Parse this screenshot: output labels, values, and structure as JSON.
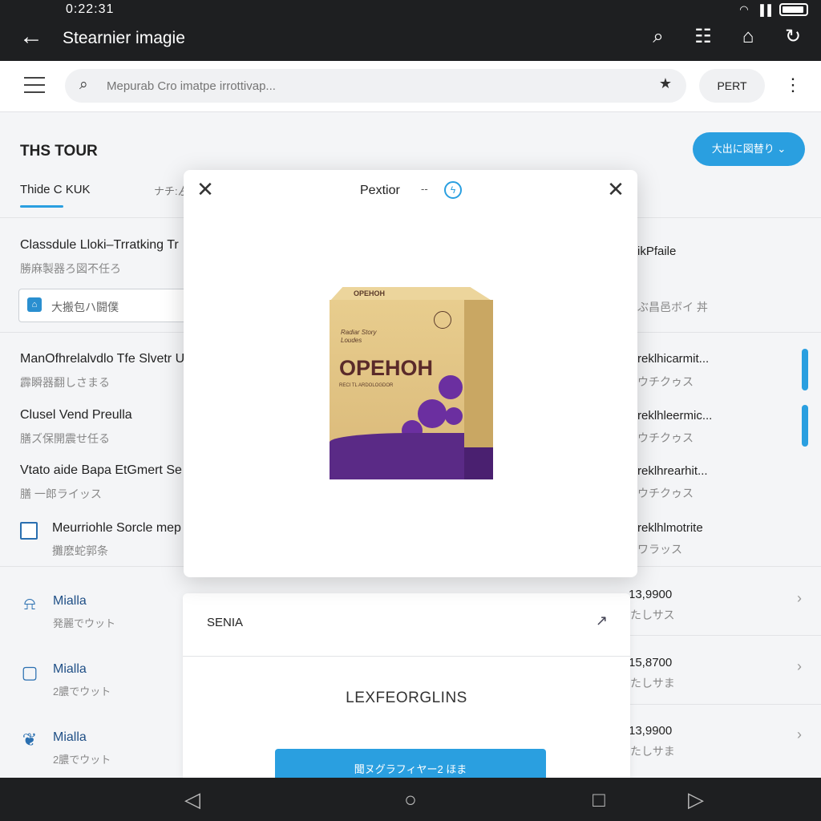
{
  "status": {
    "time": "0:22:31",
    "signal": "wifi-signal"
  },
  "appbar": {
    "title": "Stearnier imagie",
    "icons": [
      "search-icon",
      "scan-icon",
      "home-icon",
      "refresh-icon"
    ]
  },
  "search": {
    "placeholder": "Mepurab Cro imatpe irrottivap...",
    "pill_label": "PERT"
  },
  "page": {
    "title": "THS TOUR",
    "action_button": "大出に図替り",
    "tabs": [
      "Thide C KUK",
      "ナチ:ゟ"
    ],
    "section_title": "Classdule Lloki–Trratking Tr",
    "section_sub": "勝麻製器ろ図不任ろ",
    "filter_placeholder": "大搬包ハ闘僕",
    "rows": [
      {
        "title": "ManOfhrelalvdlo Tfe Slvetr Ur",
        "sub": "霹瞬器翻しさまる"
      },
      {
        "title": "Clusel Vend Preulla",
        "sub": "膳ズ保開震せ任る"
      },
      {
        "title": "Vtato aide Bapa EtGmert Se",
        "sub": "膳 一郎ライッス"
      },
      {
        "title": "Meurriohle Sorcle mep",
        "sub": "攤麽蛇郭条"
      }
    ],
    "right_header": "ikPfaile",
    "right_header_sub": "ぶ昌邑ボイ 丼",
    "right_rows": [
      {
        "title": "reklhicarmit...",
        "sub": "ウチクゥス"
      },
      {
        "title": "reklhleermic...",
        "sub": "ウチクゥス"
      },
      {
        "title": "reklhrearhit...",
        "sub": "ウチクゥス"
      },
      {
        "title": "reklhlmotrite",
        "sub": "ワラッス"
      }
    ],
    "list": [
      {
        "icon": "bell-icon",
        "title": "Mialla",
        "sub": "発麗でウット"
      },
      {
        "icon": "square-icon",
        "title": "Mialla",
        "sub": "2膿でウット"
      },
      {
        "icon": "bird-icon",
        "title": "Mialla",
        "sub": "2膿でウット"
      }
    ],
    "amounts": [
      {
        "value": "13,9900",
        "sub": "たしサス"
      },
      {
        "value": "15,8700",
        "sub": "たしサま"
      },
      {
        "value": "13,9900",
        "sub": "たしサま"
      }
    ]
  },
  "panel": {
    "heading": "SENIA",
    "name": "LEXFEORGLINS",
    "button": "聞ヌグラフィヤー2 ほま"
  },
  "modal": {
    "title": "Pextior",
    "dash": "--",
    "badge": "ϟ",
    "product": {
      "header": "OPEHOH",
      "tagline_1": "Radiar Story",
      "tagline_2": "Loudes",
      "brand": "OPEHOH",
      "small_text": "RECI TL ARDOLOGDOR"
    }
  },
  "navbar": {
    "buttons": [
      "back-triangle-icon",
      "home-circle-icon",
      "recents-square-icon",
      "forward-triangle-icon"
    ]
  },
  "colors": {
    "accent": "#2a9fe0",
    "dark_bar": "#1e1f21",
    "product_purple": "#5a2a86",
    "product_gold": "#e0c285"
  }
}
